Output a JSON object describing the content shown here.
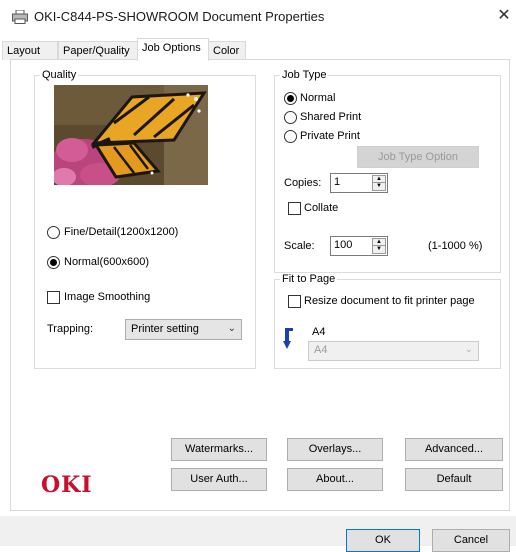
{
  "window": {
    "title": "OKI-C844-PS-SHOWROOM Document Properties",
    "close_glyph": "✕"
  },
  "tabs": [
    {
      "label": "Layout"
    },
    {
      "label": "Paper/Quality"
    },
    {
      "label": "Job Options",
      "active": true
    },
    {
      "label": "Color"
    }
  ],
  "quality": {
    "group_label": "Quality",
    "options": [
      {
        "label": "Fine/Detail(1200x1200)",
        "checked": false
      },
      {
        "label": "Normal(600x600)",
        "checked": true
      }
    ],
    "image_smoothing_label": "Image Smoothing",
    "image_smoothing_checked": false,
    "trapping_label": "Trapping:",
    "trapping_value": "Printer setting"
  },
  "job_type": {
    "group_label": "Job Type",
    "options": [
      {
        "label": "Normal",
        "checked": true
      },
      {
        "label": "Shared Print",
        "checked": false
      },
      {
        "label": "Private Print",
        "checked": false
      }
    ],
    "option_button": "Job Type Option",
    "copies_label": "Copies:",
    "copies_value": "1",
    "collate_label": "Collate",
    "collate_checked": false,
    "scale_label": "Scale:",
    "scale_value": "100",
    "scale_range": "(1-1000 %)"
  },
  "fit_to_page": {
    "group_label": "Fit to Page",
    "resize_label": "Resize document to fit printer page",
    "resize_checked": false,
    "source_size": "A4",
    "target_size": "A4"
  },
  "buttons": {
    "watermarks": "Watermarks...",
    "overlays": "Overlays...",
    "advanced": "Advanced...",
    "user_auth": "User Auth...",
    "about": "About...",
    "default": "Default"
  },
  "footer": {
    "ok": "OK",
    "cancel": "Cancel"
  },
  "brand": {
    "logo_text": "OKI",
    "color": "#c8102e"
  },
  "colors": {
    "accent": "#0078d7",
    "fit_arrow": "#1f3fb0"
  }
}
